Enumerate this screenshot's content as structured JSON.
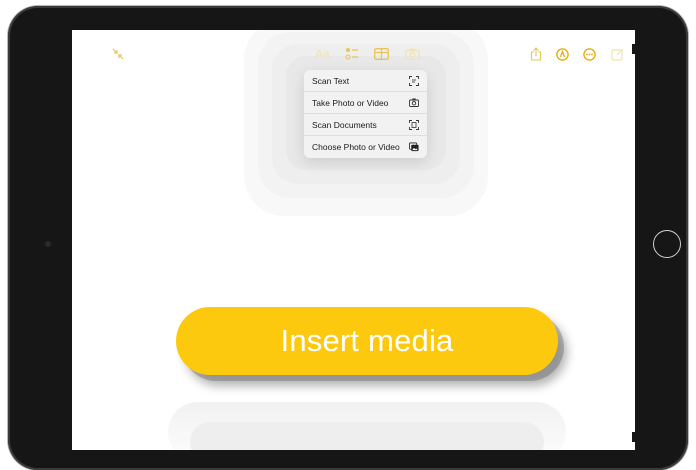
{
  "toolbar": {
    "format_label": "Aa",
    "icons": [
      "collapse-icon",
      "format-icon",
      "checklist-icon",
      "table-icon",
      "camera-icon",
      "share-icon",
      "markup-icon",
      "more-icon",
      "compose-icon"
    ]
  },
  "menu": {
    "items": [
      {
        "label": "Scan Text",
        "icon": "scan-text-icon"
      },
      {
        "label": "Take Photo or Video",
        "icon": "camera-icon"
      },
      {
        "label": "Scan Documents",
        "icon": "scan-document-icon"
      },
      {
        "label": "Choose Photo or Video",
        "icon": "photo-library-icon"
      }
    ]
  },
  "callout": {
    "label": "Insert media"
  },
  "colors": {
    "accent": "#fdc90f",
    "toolbar_icon": "#e5c55a",
    "bezel": "#161616"
  }
}
